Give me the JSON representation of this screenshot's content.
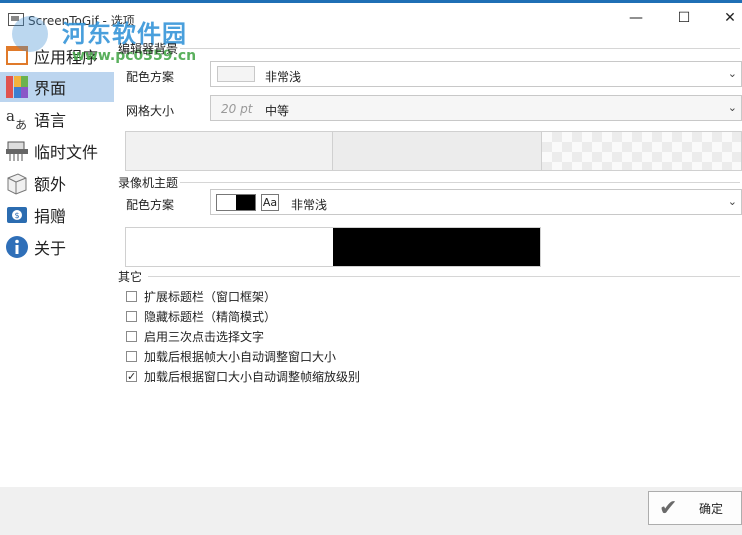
{
  "window": {
    "title": "ScreenToGif - 选项",
    "minimize": "—",
    "maximize": "☐",
    "close": "✕"
  },
  "watermark": {
    "text": "河东软件园",
    "url": "www.pc0359.cn"
  },
  "sidebar": {
    "items": [
      {
        "label": "应用程序",
        "icon": "app-window-icon"
      },
      {
        "label": "界面",
        "icon": "color-grid-icon"
      },
      {
        "label": "语言",
        "icon": "language-icon"
      },
      {
        "label": "临时文件",
        "icon": "shredder-icon"
      },
      {
        "label": "额外",
        "icon": "cube-icon"
      },
      {
        "label": "捐赠",
        "icon": "donate-icon"
      },
      {
        "label": "关于",
        "icon": "info-icon"
      }
    ],
    "selected": "界面"
  },
  "editor": {
    "title": "编辑器背景",
    "scheme_label": "配色方案",
    "scheme_value": "非常浅",
    "grid_label": "网格大小",
    "grid_size": "20 pt",
    "grid_value": "中等"
  },
  "recorder": {
    "title": "录像机主题",
    "scheme_label": "配色方案",
    "aa": "Aa",
    "scheme_value": "非常浅"
  },
  "other": {
    "title": "其它",
    "options": [
      {
        "label": "扩展标题栏（窗口框架）",
        "checked": false
      },
      {
        "label": "隐藏标题栏（精简模式）",
        "checked": false
      },
      {
        "label": "启用三次点击选择文字",
        "checked": false
      },
      {
        "label": "加载后根据帧大小自动调整窗口大小",
        "checked": false
      },
      {
        "label": "加载后根据窗口大小自动调整帧缩放级别",
        "checked": true
      }
    ]
  },
  "footer": {
    "ok_label": "确定"
  }
}
